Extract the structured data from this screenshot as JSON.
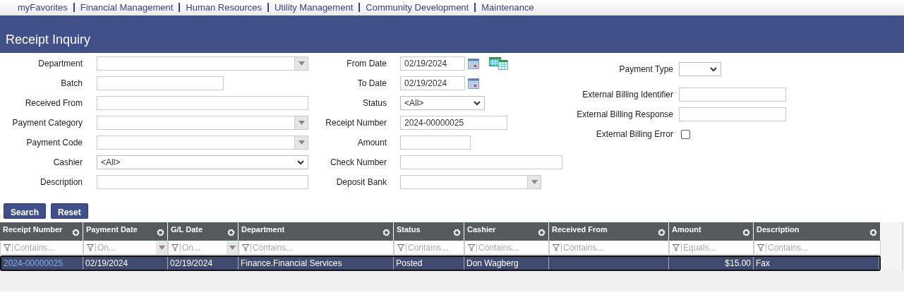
{
  "nav": {
    "links": [
      "myFavorites",
      "Financial Management",
      "Human Resources",
      "Utility Management",
      "Community Development",
      "Maintenance"
    ]
  },
  "page": {
    "title": "Receipt Inquiry"
  },
  "form": {
    "columns": [
      {
        "fields": [
          {
            "label": "Department",
            "kind": "combo"
          },
          {
            "label": "Batch",
            "kind": "text"
          },
          {
            "label": "Received From",
            "kind": "text"
          },
          {
            "label": "Payment Category",
            "kind": "combo"
          },
          {
            "label": "Payment Code",
            "kind": "combo"
          },
          {
            "label": "Cashier",
            "kind": "select",
            "value": "<All>"
          },
          {
            "label": "Description",
            "kind": "text"
          }
        ]
      },
      {
        "fields": [
          {
            "label": "From Date",
            "kind": "daterange",
            "value": "02/19/2024"
          },
          {
            "label": "To Date",
            "kind": "date",
            "value": "02/19/2024"
          },
          {
            "label": "Status",
            "kind": "select",
            "value": "<All>"
          },
          {
            "label": "Receipt Number",
            "kind": "text",
            "value": "2024-00000025"
          },
          {
            "label": "Amount",
            "kind": "text"
          },
          {
            "label": "Check Number",
            "kind": "text"
          },
          {
            "label": "Deposit Bank",
            "kind": "combo"
          }
        ]
      },
      {
        "fields": [
          {
            "label": "Payment Type",
            "kind": "select"
          },
          {
            "label": "External Billing Identifier",
            "kind": "text"
          },
          {
            "label": "External Billing Response",
            "kind": "text"
          },
          {
            "label": "External Billing Error",
            "kind": "checkbox",
            "checked": false
          }
        ]
      }
    ]
  },
  "buttons": [
    "Search",
    "Reset"
  ],
  "grid": {
    "columns": [
      {
        "label": "Receipt Number",
        "kind": "text",
        "filter_placeholder": "Contains..."
      },
      {
        "label": "Payment Date",
        "kind": "date",
        "filter_placeholder": "On..."
      },
      {
        "label": "G/L Date",
        "kind": "date",
        "filter_placeholder": "On..."
      },
      {
        "label": "Department",
        "kind": "text",
        "filter_placeholder": "Contains..."
      },
      {
        "label": "Status",
        "kind": "text",
        "filter_placeholder": "Contains..."
      },
      {
        "label": "Cashier",
        "kind": "text",
        "filter_placeholder": "Contains..."
      },
      {
        "label": "Received From",
        "kind": "text",
        "filter_placeholder": "Contains..."
      },
      {
        "label": "Amount",
        "kind": "number",
        "filter_placeholder": "Equals..."
      },
      {
        "label": "Description",
        "kind": "text",
        "filter_placeholder": "Contains..."
      }
    ],
    "rows": [
      {
        "selected": true,
        "cells": [
          "2024-00000025",
          "02/19/2024",
          "02/19/2024",
          "Finance.Financial Services",
          "Posted",
          "Don Wagberg",
          "",
          "$15.00",
          "Fax"
        ]
      }
    ]
  }
}
